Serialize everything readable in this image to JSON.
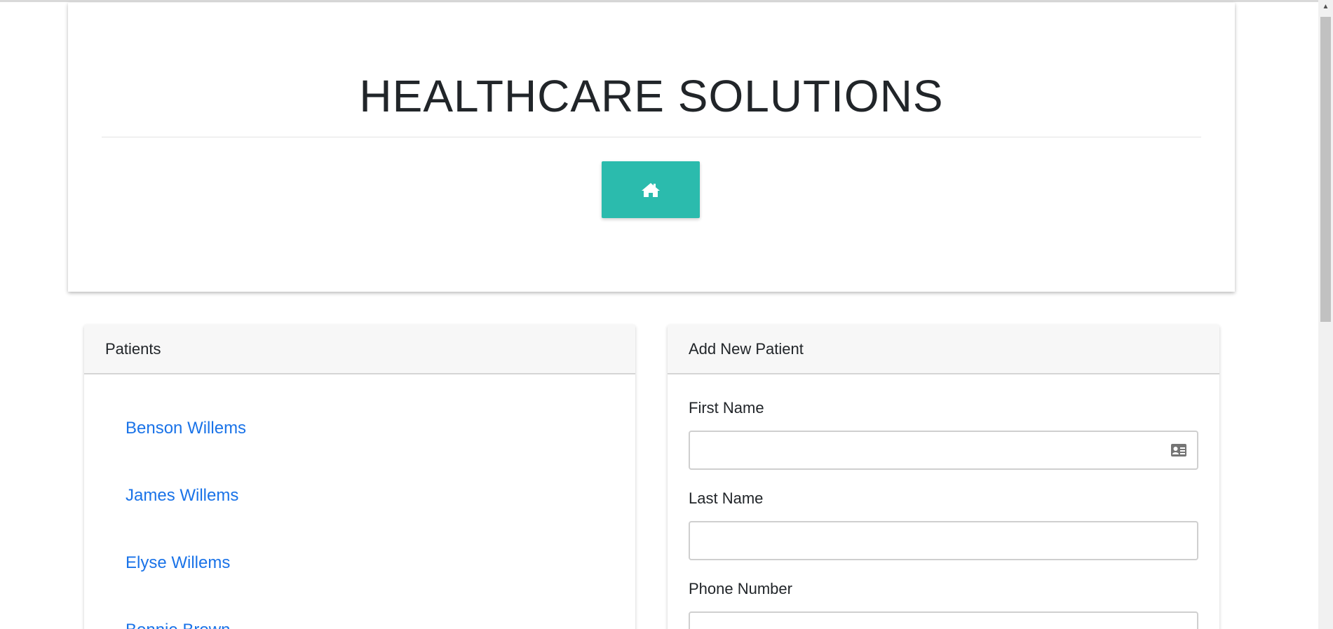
{
  "header": {
    "title": "HEALTHCARE SOLUTIONS",
    "home_button_icon": "home-icon",
    "accent_color": "#2bbbad"
  },
  "patients_card": {
    "title": "Patients",
    "patients": [
      "Benson Willems",
      "James Willems",
      "Elyse Willems",
      "Bonnie Brown"
    ],
    "link_color": "#1a73e8"
  },
  "add_patient_card": {
    "title": "Add New Patient",
    "fields": [
      {
        "label": "First Name",
        "value": "",
        "icon": "contact-card-icon"
      },
      {
        "label": "Last Name",
        "value": ""
      },
      {
        "label": "Phone Number",
        "value": ""
      }
    ]
  }
}
